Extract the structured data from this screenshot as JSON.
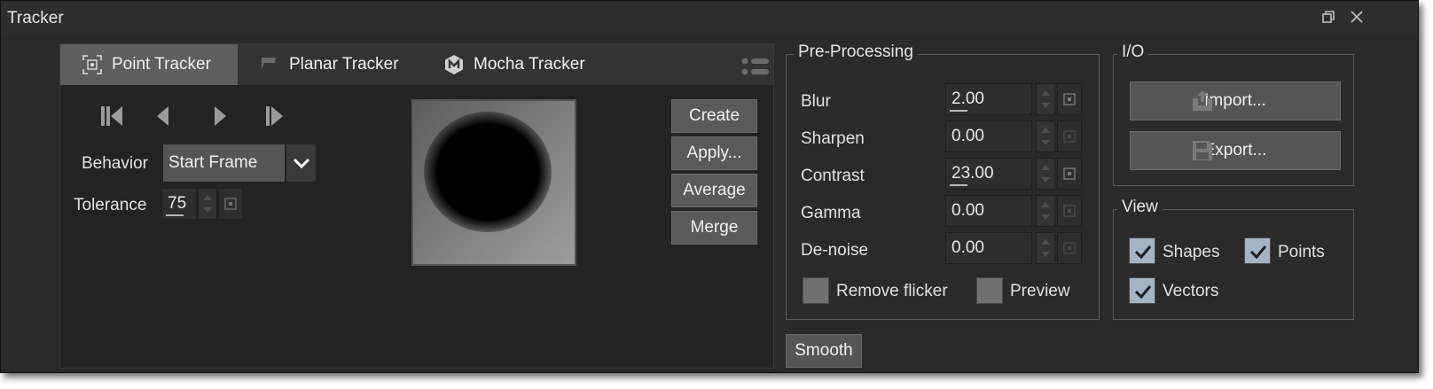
{
  "window": {
    "title": "Tracker",
    "restore_icon": "restore-icon",
    "close_icon": "close-icon"
  },
  "tabs": [
    {
      "label": "Point Tracker",
      "icon": "point-tracker-icon",
      "active": true
    },
    {
      "label": "Planar Tracker",
      "icon": "flag-icon",
      "active": false
    },
    {
      "label": "Mocha Tracker",
      "icon": "mocha-icon",
      "active": false
    }
  ],
  "nav_icons": [
    "skip-to-start-icon",
    "step-back-icon",
    "step-forward-icon",
    "skip-to-end-icon"
  ],
  "behavior": {
    "label": "Behavior",
    "value": "Start Frame"
  },
  "tolerance": {
    "label": "Tolerance",
    "value": "75"
  },
  "actions": {
    "create": "Create",
    "apply": "Apply...",
    "average": "Average",
    "merge": "Merge"
  },
  "preprocessing": {
    "title": "Pre-Processing",
    "rows": [
      {
        "label": "Blur",
        "value": "2.00"
      },
      {
        "label": "Sharpen",
        "value": "0.00"
      },
      {
        "label": "Contrast",
        "value": "23.00"
      },
      {
        "label": "Gamma",
        "value": "0.00"
      },
      {
        "label": "De-noise",
        "value": "0.00"
      }
    ],
    "remove_flicker": {
      "label": "Remove flicker",
      "checked": false
    },
    "preview": {
      "label": "Preview",
      "checked": false
    }
  },
  "io": {
    "title": "I/O",
    "import": "Import...",
    "export": "Export..."
  },
  "view": {
    "title": "View",
    "shapes": {
      "label": "Shapes",
      "checked": true
    },
    "points": {
      "label": "Points",
      "checked": true
    },
    "vectors": {
      "label": "Vectors",
      "checked": true
    }
  },
  "smooth": "Smooth",
  "colors": {
    "background": "#2a2a2a",
    "active_tab": "#5e5e5e",
    "checkbox_on": "#a5b4c4"
  }
}
